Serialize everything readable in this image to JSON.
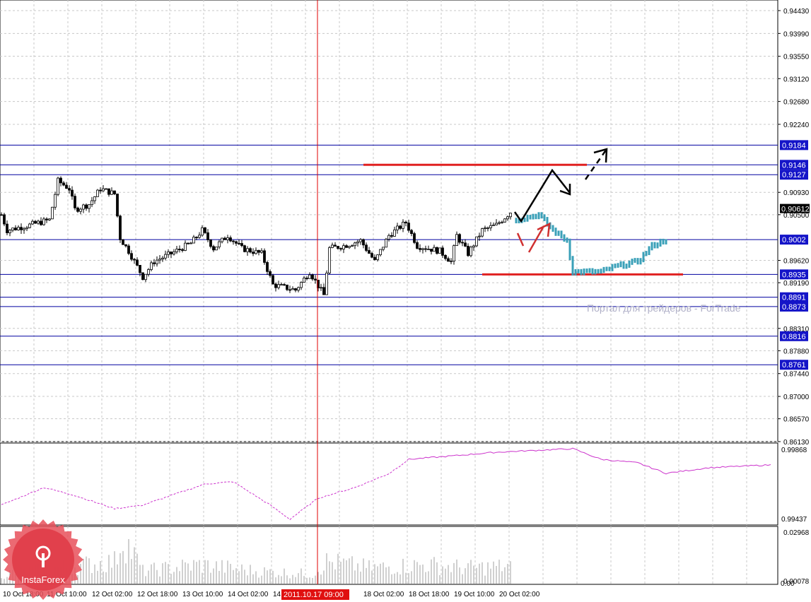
{
  "chart_data": {
    "type": "candlestick",
    "symbol_panel": "price",
    "price_axis": {
      "ticks": [
        "0.94430",
        "0.93990",
        "0.93550",
        "0.93120",
        "0.92680",
        "0.92240",
        "0.90930",
        "0.90500",
        "0.89620",
        "0.89190",
        "0.88310",
        "0.87880",
        "0.87440",
        "0.87000",
        "0.86570",
        "0.86130"
      ],
      "range": [
        0.8613,
        0.9443
      ]
    },
    "current_price": "0.90612",
    "levels": [
      "0.9184",
      "0.9146",
      "0.9127",
      "0.9002",
      "0.8935",
      "0.8891",
      "0.8873",
      "0.8816",
      "0.8761"
    ],
    "red_levels": [
      {
        "price": 0.9146,
        "from_bar": 128,
        "to_bar": 207
      },
      {
        "price": 0.8935,
        "from_bar": 170,
        "to_bar": 241
      }
    ],
    "cursor_time": "2011.10.17 09:00",
    "cursor_bar": 112,
    "time_axis": [
      "10 Oct 18:00",
      "11 Oct 10:00",
      "12 Oct 02:00",
      "12 Oct 18:00",
      "13 Oct 10:00",
      "14 Oct 02:00",
      "14",
      "18 Oct 02:00",
      "18 Oct 18:00",
      "19 Oct 10:00",
      "20 Oct 02:00"
    ],
    "history_anchors": [
      [
        0,
        0.905
      ],
      [
        2,
        0.902
      ],
      [
        10,
        0.903
      ],
      [
        17,
        0.904
      ],
      [
        20,
        0.9115
      ],
      [
        24,
        0.91
      ],
      [
        26,
        0.906
      ],
      [
        31,
        0.907
      ],
      [
        35,
        0.91
      ],
      [
        40,
        0.909
      ],
      [
        42,
        0.9005
      ],
      [
        45,
        0.898
      ],
      [
        50,
        0.893
      ],
      [
        54,
        0.896
      ],
      [
        60,
        0.8975
      ],
      [
        67,
        0.8995
      ],
      [
        71,
        0.902
      ],
      [
        75,
        0.8985
      ],
      [
        80,
        0.901
      ],
      [
        85,
        0.8985
      ],
      [
        92,
        0.8975
      ],
      [
        96,
        0.8915
      ],
      [
        104,
        0.8905
      ],
      [
        109,
        0.894
      ],
      [
        114,
        0.8895
      ],
      [
        116,
        0.8985
      ],
      [
        121,
        0.899
      ],
      [
        127,
        0.9
      ],
      [
        132,
        0.896
      ],
      [
        137,
        0.901
      ],
      [
        143,
        0.9035
      ],
      [
        147,
        0.899
      ],
      [
        155,
        0.898
      ],
      [
        159,
        0.896
      ],
      [
        161,
        0.901
      ],
      [
        165,
        0.8975
      ],
      [
        170,
        0.902
      ],
      [
        175,
        0.903
      ],
      [
        180,
        0.9055
      ]
    ],
    "forecast_anchors": [
      [
        182,
        0.904
      ],
      [
        190,
        0.905
      ],
      [
        195,
        0.902
      ],
      [
        200,
        0.9
      ],
      [
        202,
        0.894
      ],
      [
        212,
        0.894
      ],
      [
        217,
        0.895
      ],
      [
        225,
        0.896
      ],
      [
        230,
        0.899
      ],
      [
        235,
        0.9002
      ]
    ],
    "oscillator": {
      "range": [
        0.99437,
        0.99868
      ],
      "ticks": [
        "0.99868",
        "0.99437"
      ],
      "anchors": [
        [
          0,
          0.99534
        ],
        [
          15,
          0.99638
        ],
        [
          25,
          0.99596
        ],
        [
          40,
          0.99513
        ],
        [
          50,
          0.99534
        ],
        [
          72,
          0.99659
        ],
        [
          82,
          0.99672
        ],
        [
          95,
          0.99534
        ],
        [
          102,
          0.9945
        ],
        [
          112,
          0.99575
        ],
        [
          125,
          0.99638
        ],
        [
          137,
          0.9972
        ],
        [
          144,
          0.99805
        ],
        [
          160,
          0.99826
        ],
        [
          175,
          0.99847
        ],
        [
          202,
          0.99868
        ],
        [
          212,
          0.99805
        ],
        [
          225,
          0.99784
        ],
        [
          235,
          0.99722
        ],
        [
          250,
          0.99755
        ],
        [
          272,
          0.99772
        ]
      ]
    },
    "volume": {
      "ticks": [
        "0.02968",
        "0.00078",
        "0.00"
      ],
      "anchors": [
        [
          0,
          0.006
        ],
        [
          20,
          0.01
        ],
        [
          40,
          0.014
        ],
        [
          43,
          0.03
        ],
        [
          50,
          0.008
        ],
        [
          70,
          0.012
        ],
        [
          90,
          0.008
        ],
        [
          110,
          0.006
        ],
        [
          115,
          0.014
        ],
        [
          130,
          0.01
        ],
        [
          150,
          0.012
        ],
        [
          165,
          0.01
        ],
        [
          180,
          0.011
        ]
      ]
    }
  },
  "annotations": {
    "watermark": "Портал для трейдеров - ForTrade"
  },
  "logo": {
    "text": "InstaForex"
  },
  "colors": {
    "level": "#0000a0",
    "red": "#e02020",
    "forecast": "#3aa0b8",
    "osc": "#cc33cc"
  }
}
